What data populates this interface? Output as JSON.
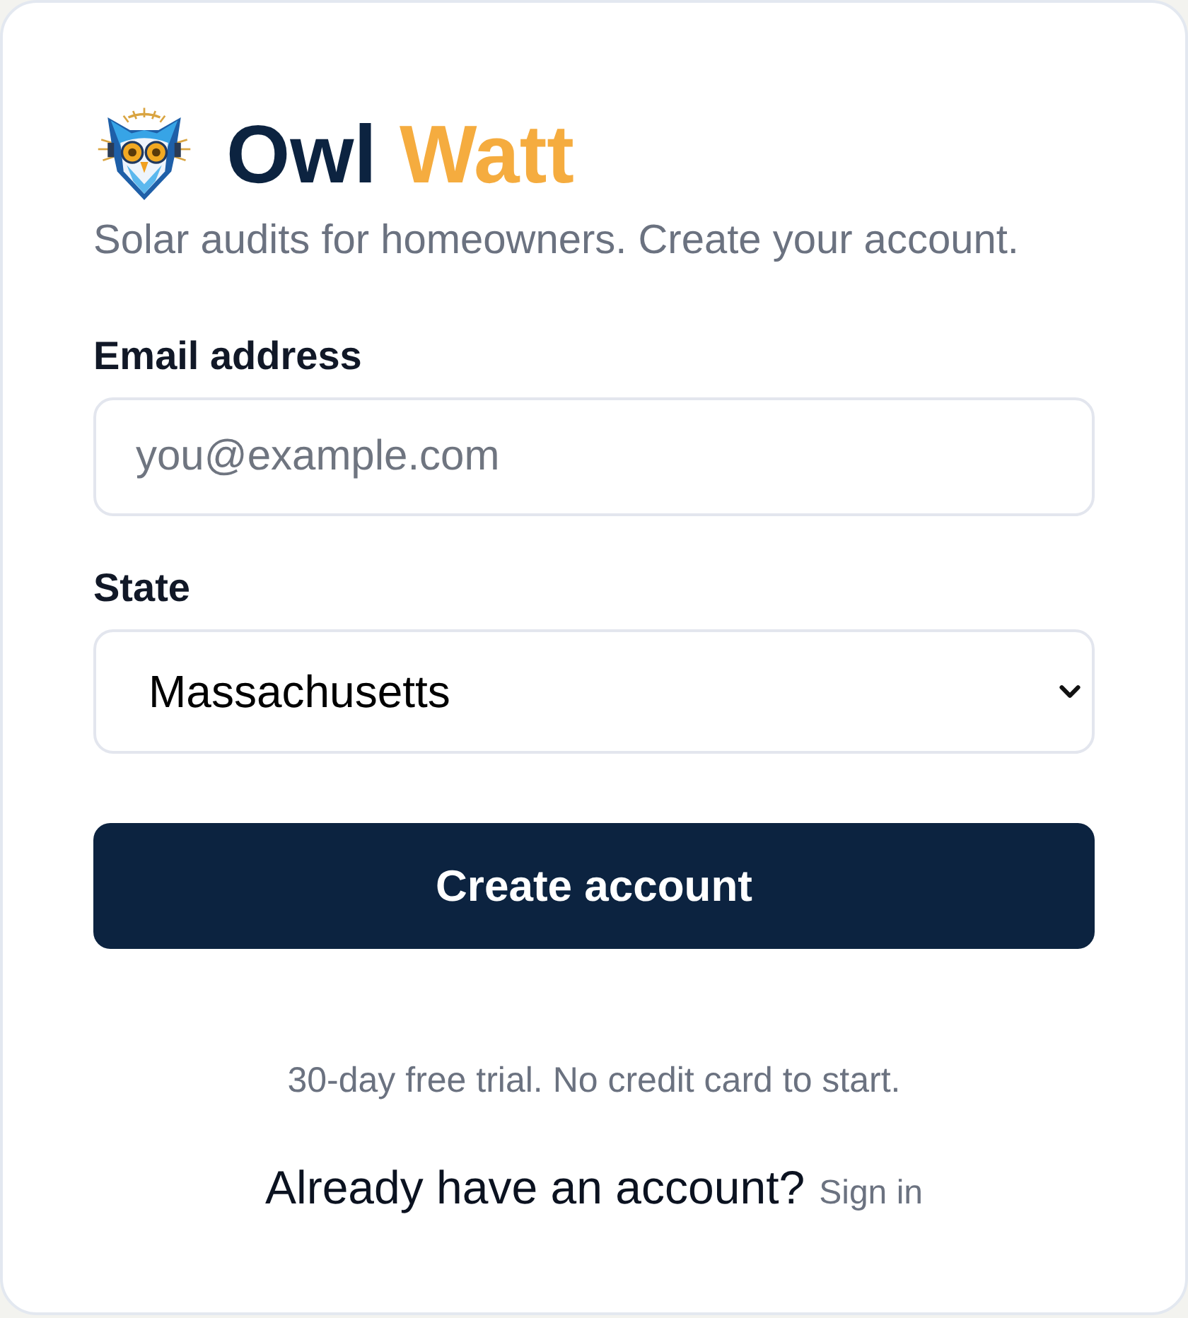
{
  "brand": {
    "name_first": "Owl",
    "name_accent": "Watt",
    "tagline": "Solar audits for homeowners. Create your account."
  },
  "form": {
    "fields": [
      {
        "kind": "text",
        "label": "Email address",
        "placeholder": "you@example.com"
      },
      {
        "kind": "select",
        "label": "State",
        "value": "Massachusetts"
      }
    ],
    "submit_button": "Create account",
    "note": "30-day free trial. No credit card to start."
  },
  "footer": {
    "prompt": "Already have an account?",
    "link": "Sign in"
  }
}
